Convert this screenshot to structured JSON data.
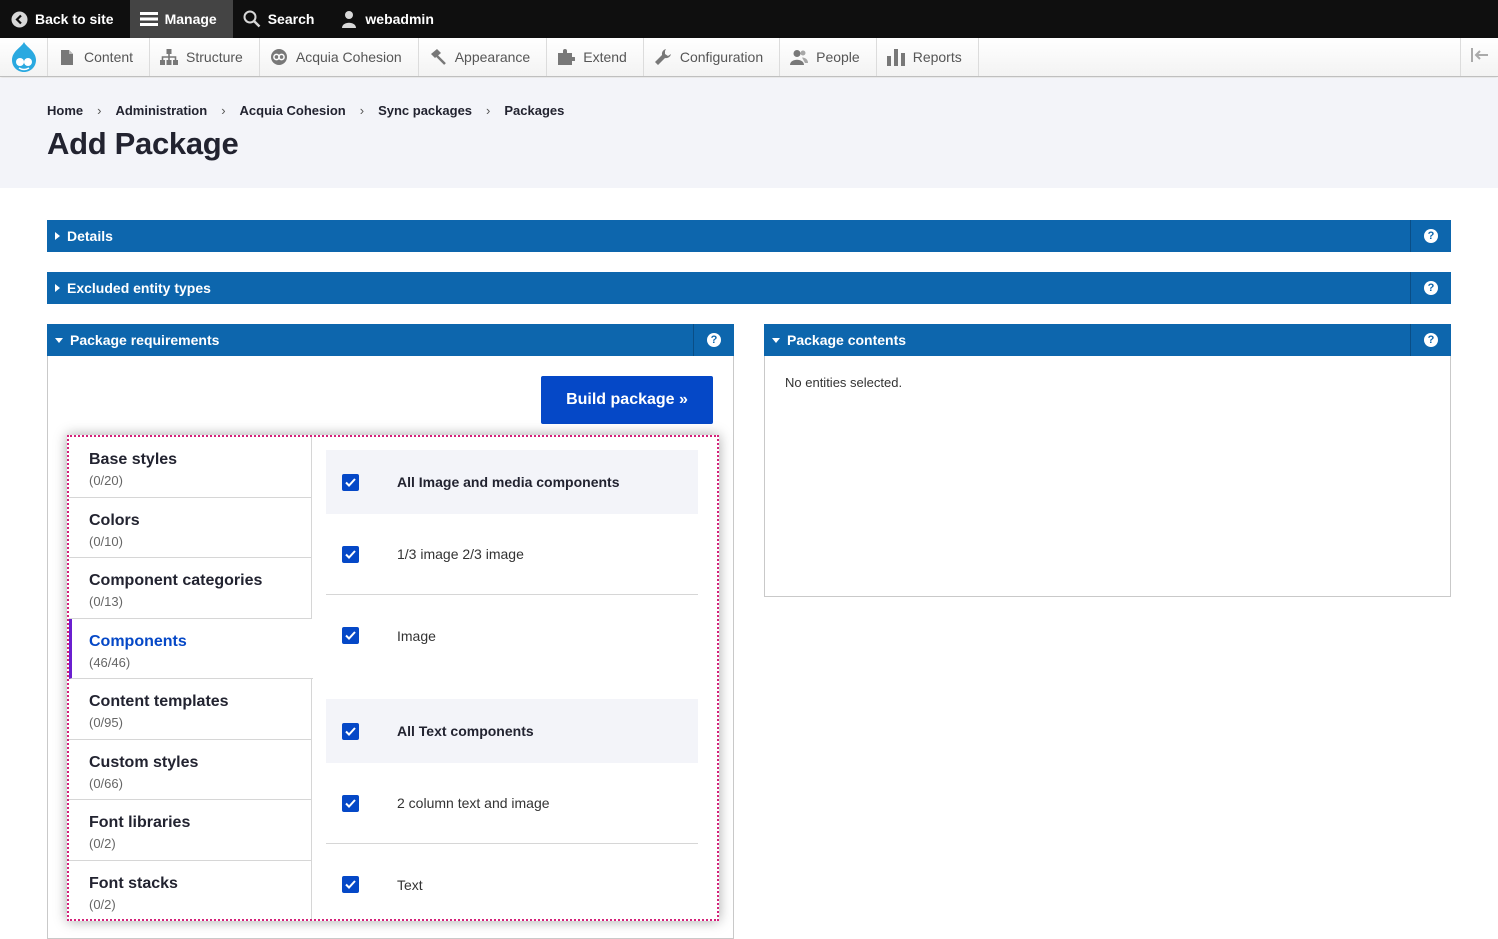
{
  "toolbar": {
    "back_label": "Back to site",
    "manage_label": "Manage",
    "search_label": "Search",
    "user_label": "webadmin"
  },
  "tray": {
    "items": [
      {
        "label": "Content",
        "icon": "document-icon"
      },
      {
        "label": "Structure",
        "icon": "sitemap-icon"
      },
      {
        "label": "Acquia Cohesion",
        "icon": "cohesion-icon"
      },
      {
        "label": "Appearance",
        "icon": "paint-icon"
      },
      {
        "label": "Extend",
        "icon": "puzzle-icon"
      },
      {
        "label": "Configuration",
        "icon": "wrench-icon"
      },
      {
        "label": "People",
        "icon": "people-icon"
      },
      {
        "label": "Reports",
        "icon": "bar-chart-icon"
      }
    ]
  },
  "breadcrumb": [
    "Home",
    "Administration",
    "Acquia Cohesion",
    "Sync packages",
    "Packages"
  ],
  "page_title": "Add Package",
  "sections": {
    "details": "Details",
    "excluded": "Excluded entity types",
    "requirements": "Package requirements",
    "contents": "Package contents"
  },
  "build_button": "Build package »",
  "contents_empty": "No entities selected.",
  "categories": [
    {
      "label": "Base styles",
      "count": "(0/20)"
    },
    {
      "label": "Colors",
      "count": "(0/10)"
    },
    {
      "label": "Component categories",
      "count": "(0/13)"
    },
    {
      "label": "Components",
      "count": "(46/46)"
    },
    {
      "label": "Content templates",
      "count": "(0/95)"
    },
    {
      "label": "Custom styles",
      "count": "(0/66)"
    },
    {
      "label": "Font libraries",
      "count": "(0/2)"
    },
    {
      "label": "Font stacks",
      "count": "(0/2)"
    }
  ],
  "component_rows": [
    {
      "label": "All Image and media components",
      "checked": true
    },
    {
      "label": "1/3 image 2/3 image",
      "checked": true
    },
    {
      "label": "Image",
      "checked": true
    },
    {
      "label": "All Text components",
      "checked": true
    },
    {
      "label": "2 column text and image",
      "checked": true
    },
    {
      "label": "Text",
      "checked": true
    }
  ],
  "colors": {
    "toolbar_bg": "#0f0f0f",
    "accordion_blue": "#0d66ad",
    "primary_button": "#0548c7",
    "highlight_border": "#d4217a"
  }
}
